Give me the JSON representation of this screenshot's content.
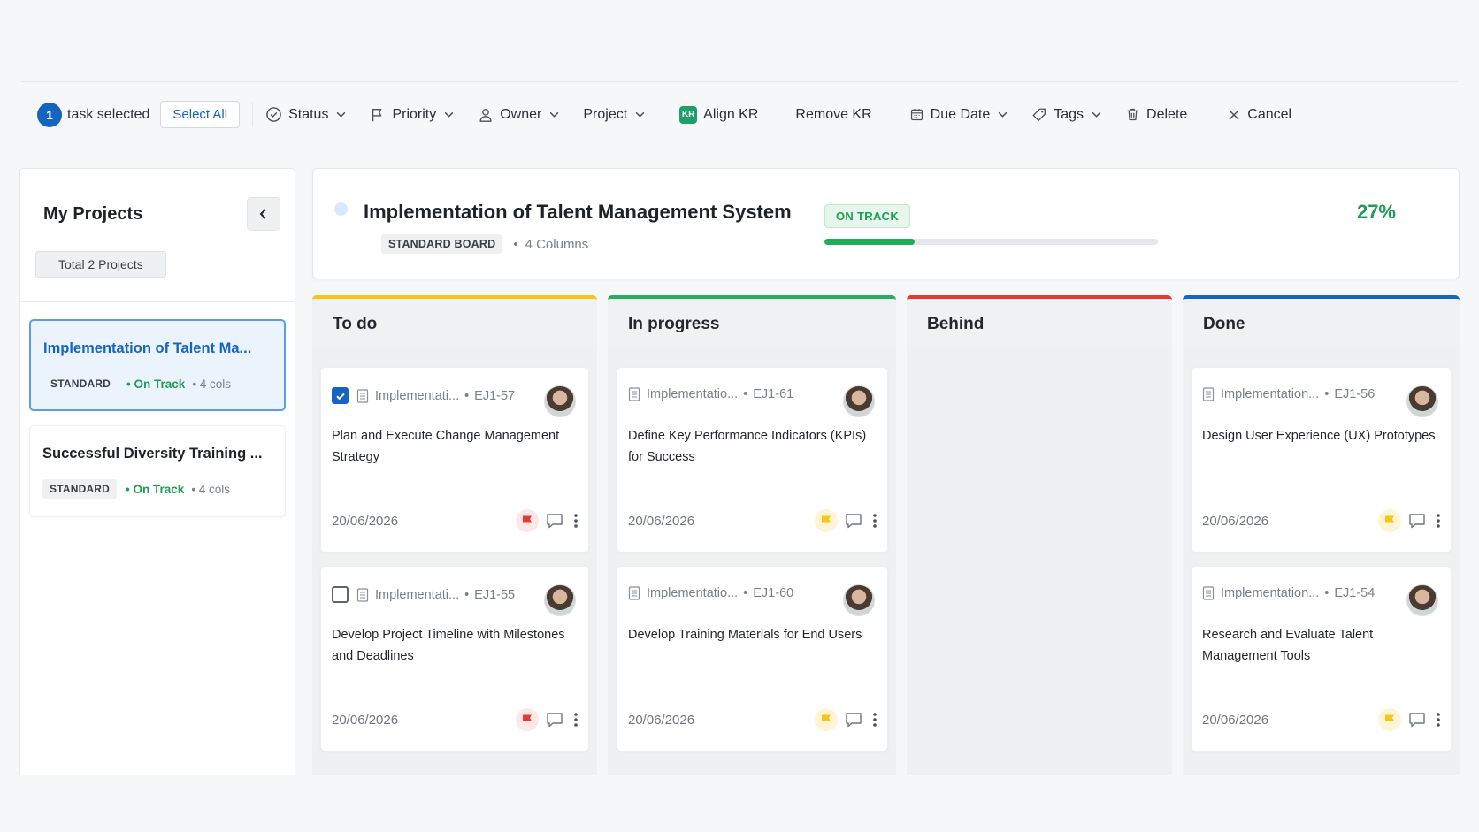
{
  "toolbar": {
    "selected_count": "1",
    "selected_label": "task selected",
    "select_all": "Select All",
    "status": "Status",
    "priority": "Priority",
    "owner": "Owner",
    "project": "Project",
    "kr_badge": "KR",
    "align_kr": "Align KR",
    "remove_kr": "Remove KR",
    "due_date": "Due Date",
    "tags": "Tags",
    "delete": "Delete",
    "cancel": "Cancel"
  },
  "sidebar": {
    "title": "My Projects",
    "total": "Total 2 Projects",
    "projects": [
      {
        "name": "Implementation of Talent Ma...",
        "type": "STANDARD",
        "status": "• On Track",
        "cols": "• 4 cols"
      },
      {
        "name": "Successful Diversity Training ...",
        "type": "STANDARD",
        "status": "• On Track",
        "cols": "• 4 cols"
      }
    ]
  },
  "project": {
    "title": "Implementation of Talent Management System",
    "board_type": "STANDARD BOARD",
    "columns_count": "4 Columns",
    "status": "ON TRACK",
    "progress_label": "27%",
    "progress": 27
  },
  "colors": {
    "todo": "#f5c518",
    "in_progress": "#27ae60",
    "behind": "#e53935",
    "done": "#1565c0",
    "flag_red": "#e53935",
    "flag_yellow": "#f5c518"
  },
  "columns": [
    {
      "title": "To do",
      "cards": [
        {
          "project": "Implementati...",
          "id": "EJ1-57",
          "title": "Plan and Execute Change Management Strategy",
          "date": "20/06/2026",
          "flag": "red"
        },
        {
          "project": "Implementati...",
          "id": "EJ1-55",
          "title": "Develop Project Timeline with Milestones and Deadlines",
          "date": "20/06/2026",
          "flag": "red"
        }
      ]
    },
    {
      "title": "In progress",
      "cards": [
        {
          "project": "Implementatio...",
          "id": "EJ1-61",
          "title": "Define Key Performance Indicators (KPIs) for Success",
          "date": "20/06/2026",
          "flag": "yellow"
        },
        {
          "project": "Implementatio...",
          "id": "EJ1-60",
          "title": "Develop Training Materials for End Users",
          "date": "20/06/2026",
          "flag": "yellow"
        }
      ]
    },
    {
      "title": "Behind",
      "cards": []
    },
    {
      "title": "Done",
      "cards": [
        {
          "project": "Implementation...",
          "id": "EJ1-56",
          "title": "Design User Experience (UX) Prototypes",
          "date": "20/06/2026",
          "flag": "yellow"
        },
        {
          "project": "Implementation...",
          "id": "EJ1-54",
          "title": "Research and Evaluate Talent Management Tools",
          "date": "20/06/2026",
          "flag": "yellow"
        }
      ]
    }
  ]
}
